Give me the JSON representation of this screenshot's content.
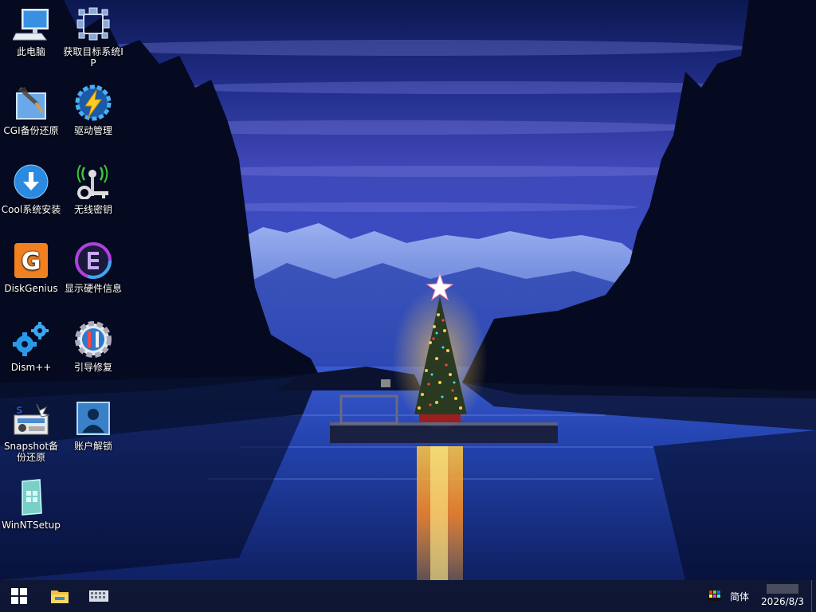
{
  "desktop": {
    "icons": [
      {
        "label": "此电脑",
        "icon": "computer-icon"
      },
      {
        "label": "获取目标系统IP",
        "icon": "network-ip-icon"
      },
      {
        "label": "CGI备份还原",
        "icon": "cgi-backup-icon"
      },
      {
        "label": "驱动管理",
        "icon": "driver-manager-icon"
      },
      {
        "label": "Cool系统安装",
        "icon": "cool-installer-icon"
      },
      {
        "label": "无线密钥",
        "icon": "wifi-key-icon"
      },
      {
        "label": "DiskGenius",
        "icon": "diskgenius-icon"
      },
      {
        "label": "显示硬件信息",
        "icon": "hardware-info-icon"
      },
      {
        "label": "Dism++",
        "icon": "dism-gears-icon"
      },
      {
        "label": "引导修复",
        "icon": "boot-repair-icon"
      },
      {
        "label": "Snapshot备份还原",
        "icon": "snapshot-icon"
      },
      {
        "label": "账户解锁",
        "icon": "account-unlock-icon"
      },
      {
        "label": "WinNTSetup",
        "icon": "winntsetup-icon"
      }
    ]
  },
  "taskbar": {
    "start": {
      "icon": "windows-start-icon"
    },
    "pinned": [
      {
        "icon": "file-explorer-icon"
      },
      {
        "icon": "on-screen-keyboard-icon"
      }
    ],
    "tray": {
      "color_icon": "color-palette-icon",
      "language": "简体",
      "date": "2026/8/3"
    }
  },
  "colors": {
    "taskbar_bg": "#10162c",
    "sky_top": "#0c1a5e",
    "sky_mid": "#3a3aa8",
    "water": "#1a3a9a"
  }
}
